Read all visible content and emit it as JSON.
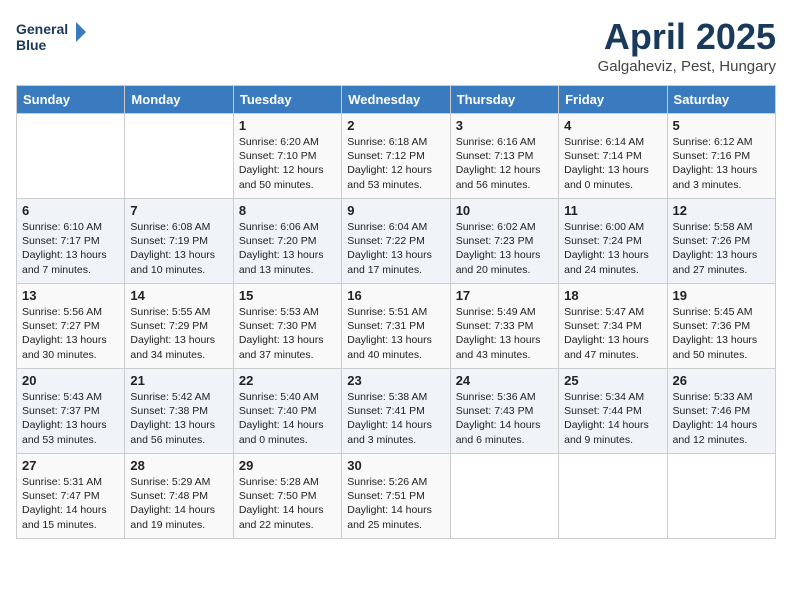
{
  "header": {
    "logo_line1": "General",
    "logo_line2": "Blue",
    "month": "April 2025",
    "location": "Galgaheviz, Pest, Hungary"
  },
  "weekdays": [
    "Sunday",
    "Monday",
    "Tuesday",
    "Wednesday",
    "Thursday",
    "Friday",
    "Saturday"
  ],
  "weeks": [
    [
      {
        "day": "",
        "info": ""
      },
      {
        "day": "",
        "info": ""
      },
      {
        "day": "1",
        "info": "Sunrise: 6:20 AM\nSunset: 7:10 PM\nDaylight: 12 hours\nand 50 minutes."
      },
      {
        "day": "2",
        "info": "Sunrise: 6:18 AM\nSunset: 7:12 PM\nDaylight: 12 hours\nand 53 minutes."
      },
      {
        "day": "3",
        "info": "Sunrise: 6:16 AM\nSunset: 7:13 PM\nDaylight: 12 hours\nand 56 minutes."
      },
      {
        "day": "4",
        "info": "Sunrise: 6:14 AM\nSunset: 7:14 PM\nDaylight: 13 hours\nand 0 minutes."
      },
      {
        "day": "5",
        "info": "Sunrise: 6:12 AM\nSunset: 7:16 PM\nDaylight: 13 hours\nand 3 minutes."
      }
    ],
    [
      {
        "day": "6",
        "info": "Sunrise: 6:10 AM\nSunset: 7:17 PM\nDaylight: 13 hours\nand 7 minutes."
      },
      {
        "day": "7",
        "info": "Sunrise: 6:08 AM\nSunset: 7:19 PM\nDaylight: 13 hours\nand 10 minutes."
      },
      {
        "day": "8",
        "info": "Sunrise: 6:06 AM\nSunset: 7:20 PM\nDaylight: 13 hours\nand 13 minutes."
      },
      {
        "day": "9",
        "info": "Sunrise: 6:04 AM\nSunset: 7:22 PM\nDaylight: 13 hours\nand 17 minutes."
      },
      {
        "day": "10",
        "info": "Sunrise: 6:02 AM\nSunset: 7:23 PM\nDaylight: 13 hours\nand 20 minutes."
      },
      {
        "day": "11",
        "info": "Sunrise: 6:00 AM\nSunset: 7:24 PM\nDaylight: 13 hours\nand 24 minutes."
      },
      {
        "day": "12",
        "info": "Sunrise: 5:58 AM\nSunset: 7:26 PM\nDaylight: 13 hours\nand 27 minutes."
      }
    ],
    [
      {
        "day": "13",
        "info": "Sunrise: 5:56 AM\nSunset: 7:27 PM\nDaylight: 13 hours\nand 30 minutes."
      },
      {
        "day": "14",
        "info": "Sunrise: 5:55 AM\nSunset: 7:29 PM\nDaylight: 13 hours\nand 34 minutes."
      },
      {
        "day": "15",
        "info": "Sunrise: 5:53 AM\nSunset: 7:30 PM\nDaylight: 13 hours\nand 37 minutes."
      },
      {
        "day": "16",
        "info": "Sunrise: 5:51 AM\nSunset: 7:31 PM\nDaylight: 13 hours\nand 40 minutes."
      },
      {
        "day": "17",
        "info": "Sunrise: 5:49 AM\nSunset: 7:33 PM\nDaylight: 13 hours\nand 43 minutes."
      },
      {
        "day": "18",
        "info": "Sunrise: 5:47 AM\nSunset: 7:34 PM\nDaylight: 13 hours\nand 47 minutes."
      },
      {
        "day": "19",
        "info": "Sunrise: 5:45 AM\nSunset: 7:36 PM\nDaylight: 13 hours\nand 50 minutes."
      }
    ],
    [
      {
        "day": "20",
        "info": "Sunrise: 5:43 AM\nSunset: 7:37 PM\nDaylight: 13 hours\nand 53 minutes."
      },
      {
        "day": "21",
        "info": "Sunrise: 5:42 AM\nSunset: 7:38 PM\nDaylight: 13 hours\nand 56 minutes."
      },
      {
        "day": "22",
        "info": "Sunrise: 5:40 AM\nSunset: 7:40 PM\nDaylight: 14 hours\nand 0 minutes."
      },
      {
        "day": "23",
        "info": "Sunrise: 5:38 AM\nSunset: 7:41 PM\nDaylight: 14 hours\nand 3 minutes."
      },
      {
        "day": "24",
        "info": "Sunrise: 5:36 AM\nSunset: 7:43 PM\nDaylight: 14 hours\nand 6 minutes."
      },
      {
        "day": "25",
        "info": "Sunrise: 5:34 AM\nSunset: 7:44 PM\nDaylight: 14 hours\nand 9 minutes."
      },
      {
        "day": "26",
        "info": "Sunrise: 5:33 AM\nSunset: 7:46 PM\nDaylight: 14 hours\nand 12 minutes."
      }
    ],
    [
      {
        "day": "27",
        "info": "Sunrise: 5:31 AM\nSunset: 7:47 PM\nDaylight: 14 hours\nand 15 minutes."
      },
      {
        "day": "28",
        "info": "Sunrise: 5:29 AM\nSunset: 7:48 PM\nDaylight: 14 hours\nand 19 minutes."
      },
      {
        "day": "29",
        "info": "Sunrise: 5:28 AM\nSunset: 7:50 PM\nDaylight: 14 hours\nand 22 minutes."
      },
      {
        "day": "30",
        "info": "Sunrise: 5:26 AM\nSunset: 7:51 PM\nDaylight: 14 hours\nand 25 minutes."
      },
      {
        "day": "",
        "info": ""
      },
      {
        "day": "",
        "info": ""
      },
      {
        "day": "",
        "info": ""
      }
    ]
  ]
}
